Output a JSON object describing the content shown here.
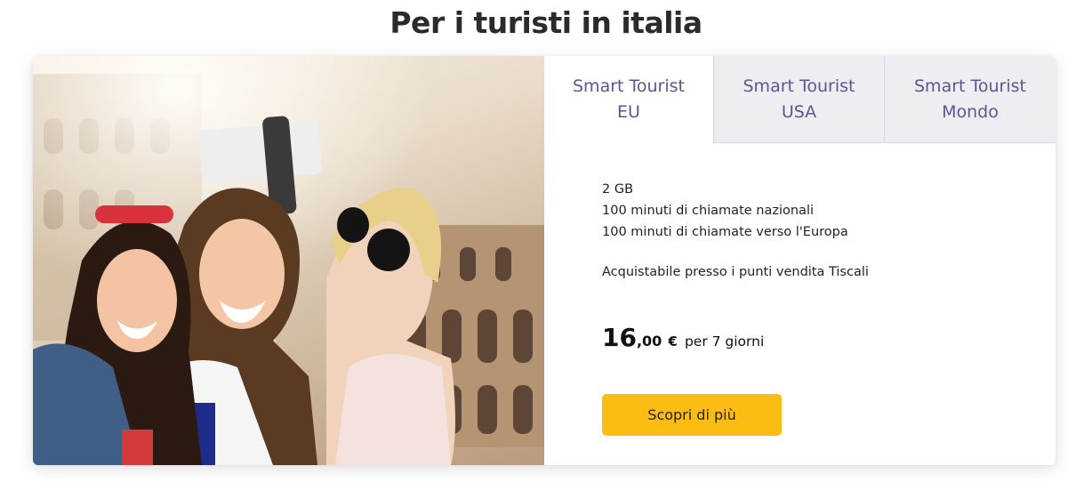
{
  "page": {
    "title": "Per i turisti in italia"
  },
  "photo": {
    "alt": "Three women taking a selfie in front of the Colosseum",
    "icon": "photo-selfie-colosseum"
  },
  "tabs": [
    {
      "label": "Smart Tourist\nEU",
      "active": true
    },
    {
      "label": "Smart Tourist\nUSA",
      "active": false
    },
    {
      "label": "Smart Tourist\nMondo",
      "active": false
    }
  ],
  "offer": {
    "features": [
      "2 GB",
      "100 minuti di chiamate nazionali",
      "100 minuti di chiamate verso l'Europa"
    ],
    "note": "Acquistabile presso i punti vendita Tiscali",
    "price": {
      "integer": "16",
      "decimals": ",00",
      "currency": "€",
      "period": "per 7 giorni"
    },
    "cta_label": "Scopri di più"
  },
  "colors": {
    "accent_tab_text": "#5f5393",
    "cta_background": "#fbbd14",
    "inactive_tab_background": "#eeedf2"
  }
}
